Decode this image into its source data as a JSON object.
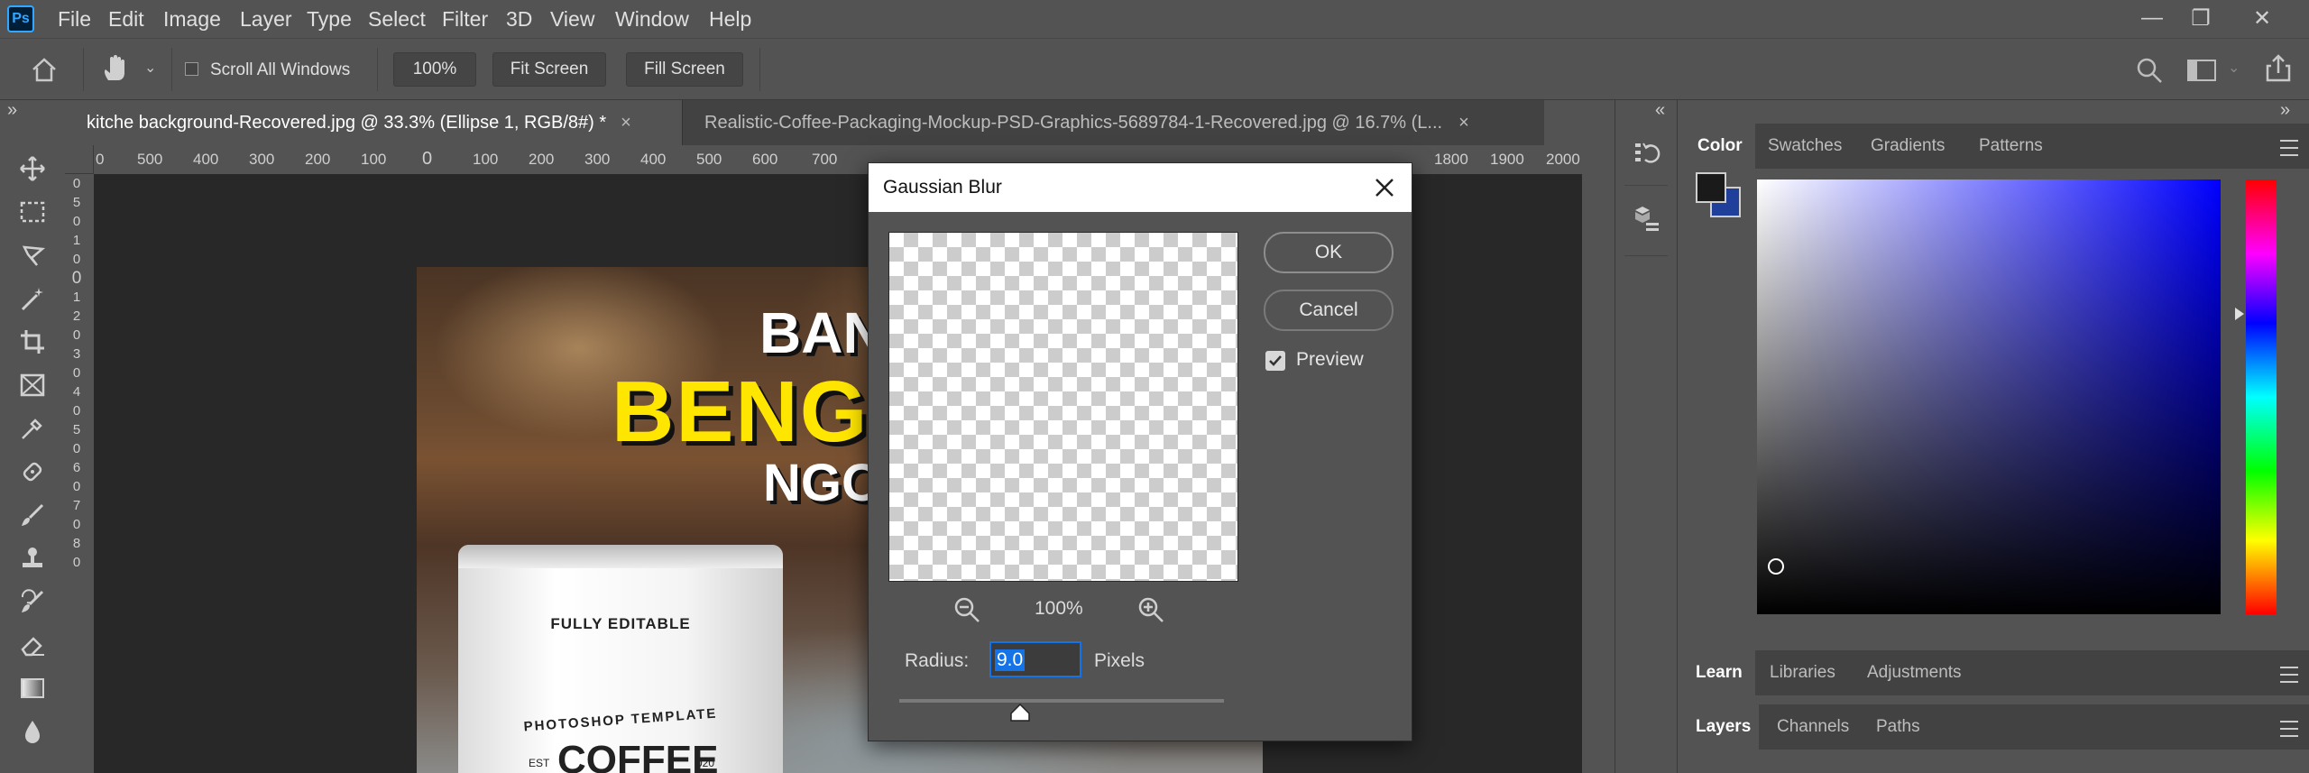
{
  "app": {
    "logo": "Ps"
  },
  "menu": [
    "File",
    "Edit",
    "Image",
    "Layer",
    "Type",
    "Select",
    "Filter",
    "3D",
    "View",
    "Window",
    "Help"
  ],
  "options_bar": {
    "scroll_all_windows": "Scroll All Windows",
    "zoom": "100%",
    "fit_screen": "Fit Screen",
    "fill_screen": "Fill Screen"
  },
  "tabs": [
    {
      "label": "kitche background-Recovered.jpg @ 33.3% (Ellipse 1, RGB/8#) *",
      "active": true
    },
    {
      "label": "Realistic-Coffee-Packaging-Mockup-PSD-Graphics-5689784-1-Recovered.jpg @ 16.7% (L...",
      "active": false
    }
  ],
  "ruler_top": [
    "0",
    "500",
    "400",
    "300",
    "200",
    "100",
    "0",
    "100",
    "200",
    "300",
    "400",
    "500",
    "600",
    "700",
    "1800",
    "1900",
    "2000"
  ],
  "ruler_left": [
    "0",
    "5",
    "0",
    "1",
    "0",
    "0",
    "1",
    "2",
    "0",
    "3",
    "0",
    "4",
    "0",
    "5",
    "0",
    "6",
    "0",
    "7",
    "0",
    "8",
    "0"
  ],
  "canvas": {
    "headline_1": "BAN",
    "headline_2": "BENG",
    "headline_3": "NGO",
    "bag_label": "FULLY EDITABLE",
    "bag_arc": "PHOTOSHOP TEMPLATE",
    "bag_brand": "COFFEE",
    "bag_est": "EST",
    "bag_year": "020"
  },
  "dialog": {
    "title": "Gaussian Blur",
    "ok": "OK",
    "cancel": "Cancel",
    "preview_label": "Preview",
    "preview_checked": true,
    "zoom": "100%",
    "radius_label": "Radius:",
    "radius_value": "9.0",
    "units": "Pixels"
  },
  "color_panel": {
    "tabs": [
      "Color",
      "Swatches",
      "Gradients",
      "Patterns"
    ],
    "foreground": "#1a1a1a",
    "background": "#1f3f9a",
    "hue": "#0000ff"
  },
  "learn_panel": {
    "tabs": [
      "Learn",
      "Libraries",
      "Adjustments"
    ]
  },
  "layers_panel": {
    "tabs": [
      "Layers",
      "Channels",
      "Paths"
    ]
  },
  "colors": {
    "accent": "#31a8ff",
    "ui_bg": "#535353",
    "dark_bg": "#282828"
  }
}
